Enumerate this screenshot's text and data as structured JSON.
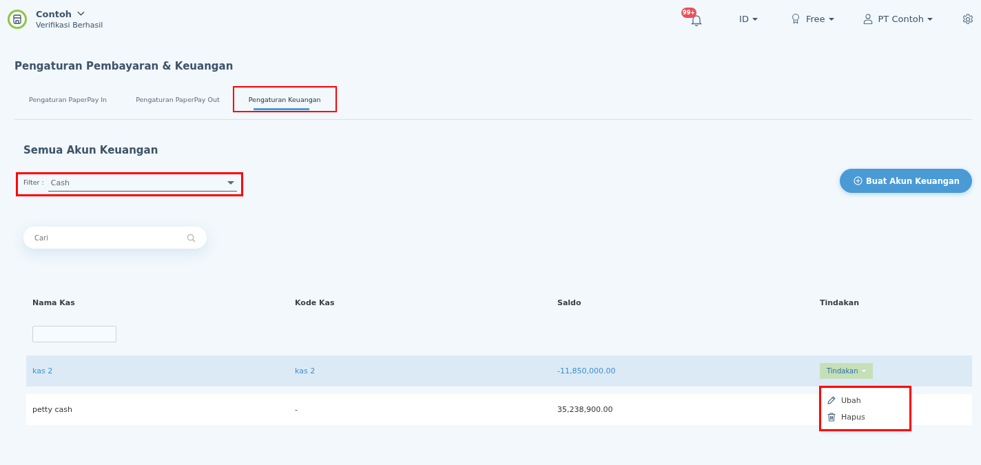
{
  "header": {
    "company": "Contoh",
    "status": "Verifikasi Berhasil",
    "notification_badge": "99+",
    "language": "ID",
    "plan": "Free",
    "user": "PT Contoh"
  },
  "page_title": "Pengaturan Pembayaran & Keuangan",
  "tabs": [
    {
      "label": "Pengaturan PaperPay In",
      "selected": false,
      "highlighted": false
    },
    {
      "label": "Pengaturan PaperPay Out",
      "selected": false,
      "highlighted": false
    },
    {
      "label": "Pengaturan Keuangan",
      "selected": true,
      "highlighted": true
    }
  ],
  "section_title": "Semua Akun Keuangan",
  "filter": {
    "label": "Filter :",
    "value": "Cash",
    "highlighted": true
  },
  "create_button": "Buat Akun Keuangan",
  "search": {
    "placeholder": "Cari"
  },
  "table": {
    "columns": [
      "Nama Kas",
      "Kode Kas",
      "Saldo",
      "Tindakan"
    ],
    "rows": [
      {
        "cells": [
          "kas 2",
          "kas 2",
          "-11,850,000.00"
        ],
        "selected": true,
        "action": "Tindakan"
      },
      {
        "cells": [
          "petty cash",
          "-",
          "35,238,900.00"
        ],
        "selected": false
      }
    ]
  },
  "action_menu": {
    "highlighted": true,
    "items": [
      {
        "kind": "edit",
        "label": "Ubah"
      },
      {
        "kind": "delete",
        "label": "Hapus"
      }
    ]
  }
}
